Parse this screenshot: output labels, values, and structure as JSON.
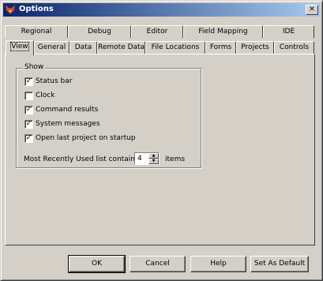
{
  "window": {
    "title": "Options"
  },
  "tabs_row1": [
    "Regional",
    "Debug",
    "Editor",
    "Field Mapping",
    "IDE"
  ],
  "tabs_row2": [
    "View",
    "General",
    "Data",
    "Remote Data",
    "File Locations",
    "Forms",
    "Projects",
    "Controls"
  ],
  "active_tab": "View",
  "show_group": {
    "label": "Show",
    "options": [
      {
        "label": "Status bar",
        "checked": true
      },
      {
        "label": "Clock",
        "checked": false
      },
      {
        "label": "Command results",
        "checked": true
      },
      {
        "label": "System messages",
        "checked": true
      },
      {
        "label": "Open last project on startup",
        "checked": true
      }
    ],
    "mru_label": "Most Recently Used list contains",
    "mru_value": "4",
    "mru_suffix": "items"
  },
  "buttons": {
    "ok": "OK",
    "cancel": "Cancel",
    "help": "Help",
    "set_default": "Set As Default"
  },
  "icons": {
    "app": "fox-icon",
    "close": "close-icon",
    "check": "checkmark-icon"
  }
}
